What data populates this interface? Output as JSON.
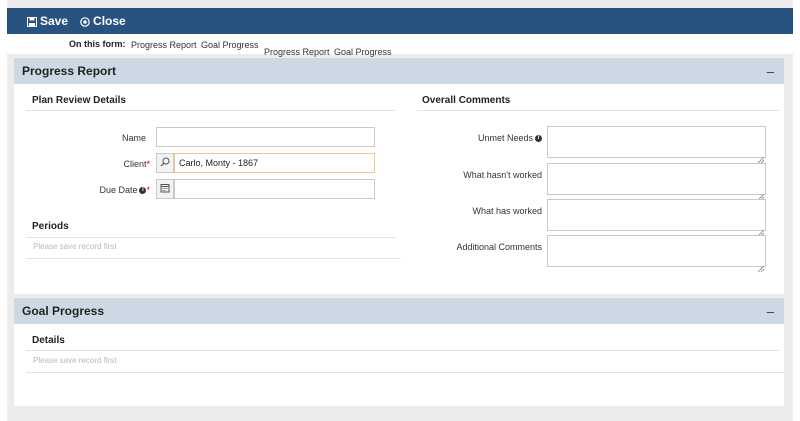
{
  "toolbar": {
    "save_label": "Save",
    "close_label": "Close"
  },
  "form_nav": {
    "label": "On this form:",
    "links": [
      "Progress Report",
      "Goal Progress"
    ],
    "links_shifted": [
      "Progress Report",
      "Goal Progress"
    ]
  },
  "progress_report": {
    "title": "Progress Report",
    "toggle": "–",
    "plan_review": {
      "title": "Plan Review Details",
      "name_label": "Name",
      "name_value": "",
      "client_label": "Client",
      "client_required": "*",
      "client_value": "Carlo, Monty - 1867",
      "due_date_label": "Due Date",
      "due_date_required": "*",
      "due_date_value": ""
    },
    "periods": {
      "title": "Periods",
      "message": "Please save record first"
    },
    "overall_comments": {
      "title": "Overall Comments",
      "unmet_needs_label": "Unmet Needs",
      "hasnt_worked_label": "What hasn't worked",
      "has_worked_label": "What has worked",
      "additional_label": "Additional Comments"
    }
  },
  "goal_progress": {
    "title": "Goal Progress",
    "toggle": "–",
    "details_title": "Details",
    "message": "Please save record first"
  },
  "colors": {
    "toolbar_bg": "#285380",
    "panel_header_bg": "#ccd9e4",
    "required": "#cc0000",
    "active_input_border": "#f0c98a"
  },
  "icons": [
    "save-icon",
    "close-circle-icon",
    "info-icon",
    "search-icon",
    "calendar-icon",
    "collapse-icon"
  ]
}
